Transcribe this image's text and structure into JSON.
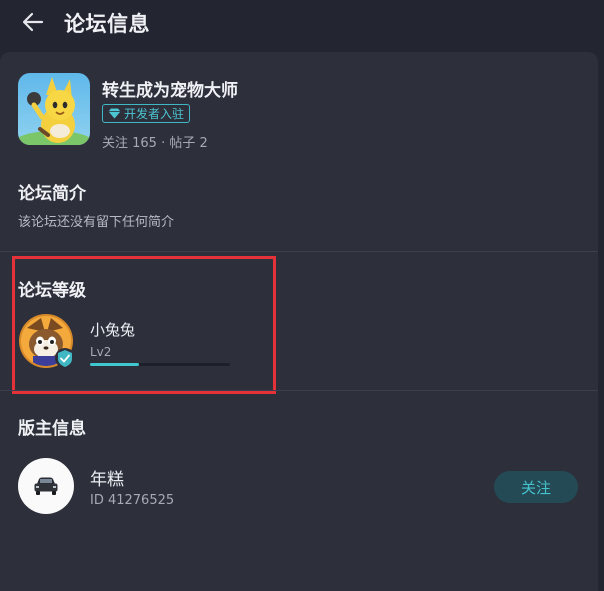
{
  "header": {
    "title": "论坛信息",
    "back_icon": "arrow-left-icon"
  },
  "forum": {
    "name": "转生成为宠物大师",
    "badge_label": "开发者入驻",
    "badge_icon": "diamond-icon",
    "stats": "关注 165 · 帖子 2"
  },
  "intro": {
    "title": "论坛简介",
    "text": "该论坛还没有留下任何简介"
  },
  "level": {
    "title": "论坛等级",
    "user_name": "小兔兔",
    "level_label": "Lv2",
    "progress": 0.35
  },
  "owner": {
    "title": "版主信息",
    "name": "年糕",
    "id_text": "ID 41276525",
    "follow_label": "关注"
  },
  "colors": {
    "background": "#232530",
    "panel": "#2d2f3b",
    "accent": "#46c2cd",
    "highlight": "#e53238"
  }
}
